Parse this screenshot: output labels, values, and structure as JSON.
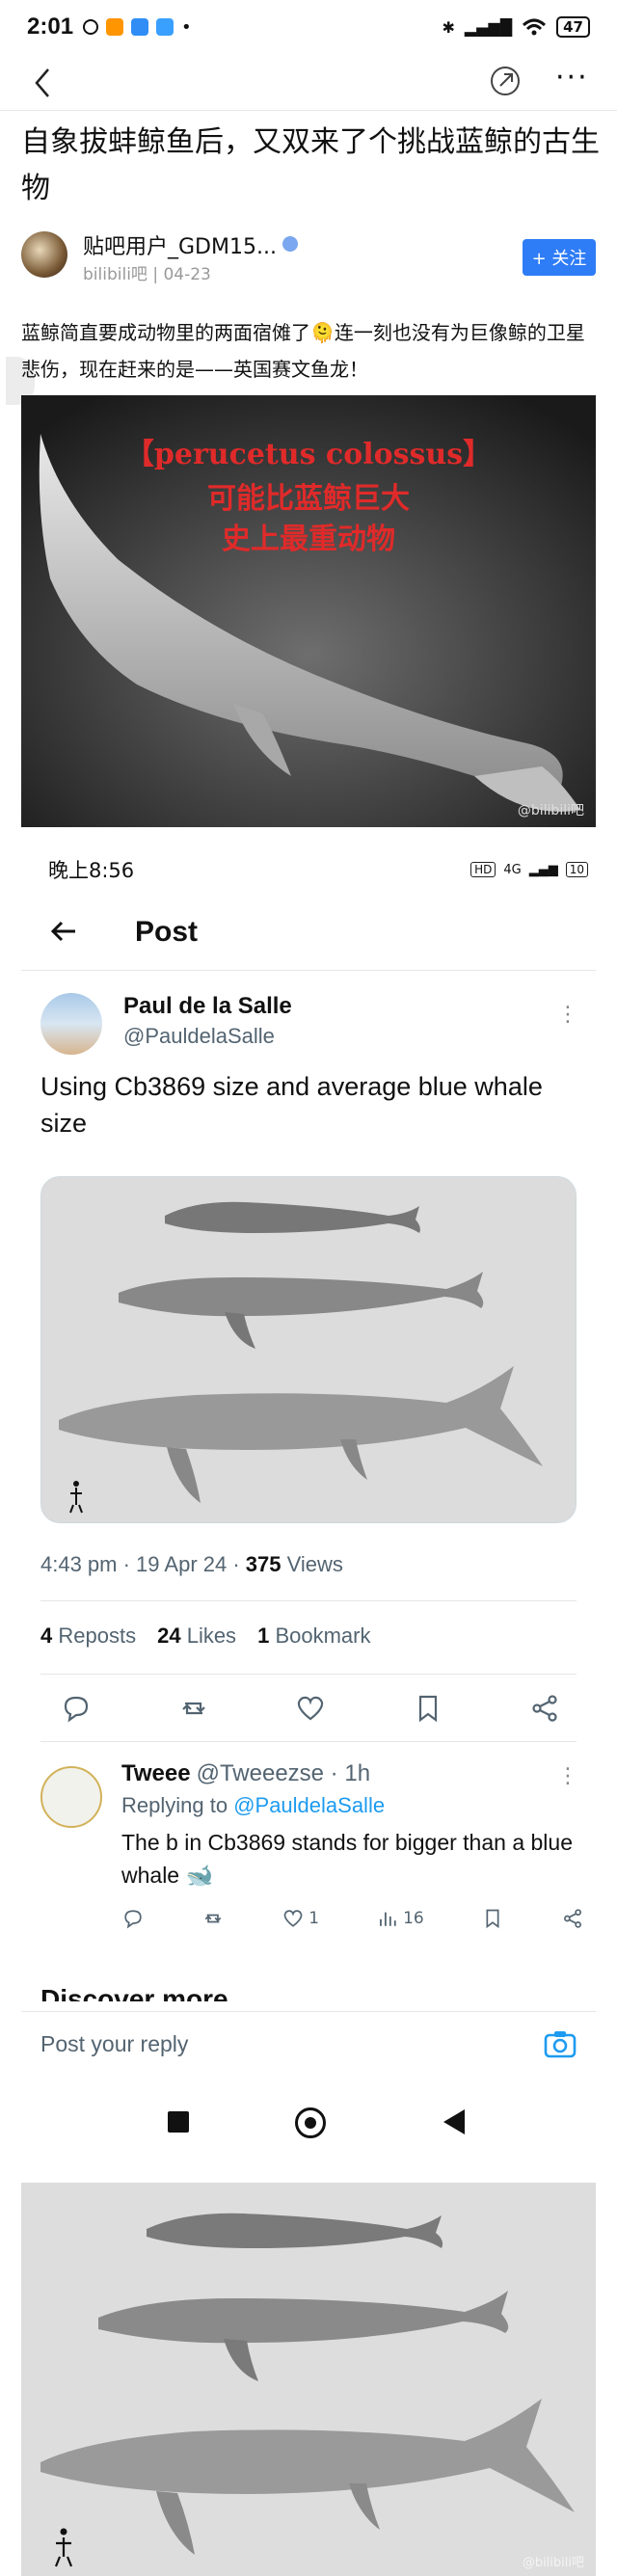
{
  "status_bar": {
    "time": "2:01",
    "battery": "47",
    "indicator_colors": [
      "#ff9500",
      "#2f8df5",
      "#3aa0ff"
    ]
  },
  "nav": {
    "back_icon": "chevron-left-icon",
    "share_icon": "share-icon",
    "more": "···"
  },
  "post": {
    "title": "自象拔蚌鲸鱼后，又双来了个挑战蓝鲸的古生物",
    "author": "贴吧用户_GDM15...",
    "source": "bilibili吧",
    "date": "04-23",
    "follow_label": "+ 关注",
    "body": "蓝鲸简直要成动物里的两面宿傩了🫠连一刻也没有为巨像鲸的卫星悲伤，现在赶来的是——英国赛文鱼龙！",
    "image1": {
      "caption_latin": "【perucetus colossus】",
      "caption_line2": "可能比蓝鲸巨大",
      "caption_line3": "史上最重动物",
      "watermark": "@bilibili吧"
    }
  },
  "embedded": {
    "status_bar": {
      "time": "晚上8:56",
      "chip1": "HD",
      "chip2": "4G",
      "battery": "10"
    },
    "nav_title": "Post",
    "tweet": {
      "name": "Paul de la Salle",
      "handle": "@PauldelaSalle",
      "text": "Using Cb3869 size and average blue whale size",
      "time": "4:43 pm · 19 Apr 24 · ",
      "views_count": "375",
      "views_label": "Views",
      "reposts_count": "4",
      "reposts_label": "Reposts",
      "likes_count": "24",
      "likes_label": "Likes",
      "bookmarks_count": "1",
      "bookmarks_label": "Bookmark"
    },
    "reply": {
      "name": "Tweee",
      "handle": "@Tweeezse · 1h",
      "replying_prefix": "Replying to ",
      "replying_handle": "@PauldelaSalle",
      "text": "The b in Cb3869 stands for bigger than a blue whale 🐋",
      "likes": "1",
      "views": "16"
    },
    "discover": "Discover more",
    "reply_placeholder": "Post your reply"
  },
  "image3": {
    "watermark": "@bilibili吧"
  }
}
